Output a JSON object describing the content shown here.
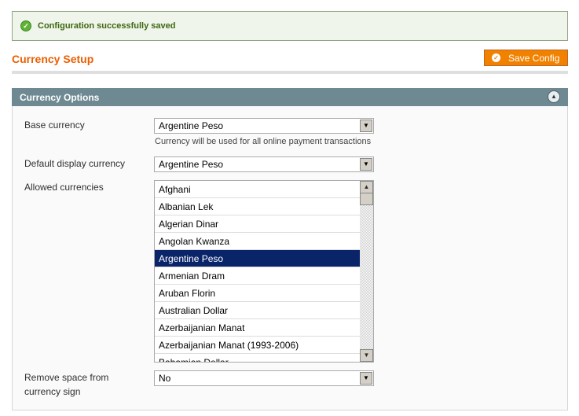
{
  "message": {
    "text": "Configuration successfully saved",
    "icon": "check-circle-icon"
  },
  "page": {
    "title": "Currency Setup",
    "save_label": "Save Config"
  },
  "section": {
    "title": "Currency Options"
  },
  "fields": {
    "base": {
      "label": "Base currency",
      "value": "Argentine Peso",
      "note": "Currency will be used for all online payment transactions"
    },
    "display": {
      "label": "Default display currency",
      "value": "Argentine Peso"
    },
    "allowed": {
      "label": "Allowed currencies",
      "options": [
        "Afghani",
        "Albanian Lek",
        "Algerian Dinar",
        "Angolan Kwanza",
        "Argentine Peso",
        "Armenian Dram",
        "Aruban Florin",
        "Australian Dollar",
        "Azerbaijanian Manat",
        "Azerbaijanian Manat (1993-2006)",
        "Bahamian Dollar"
      ],
      "selected": "Argentine Peso"
    },
    "space": {
      "label_1": "Remove space from",
      "label_2": "currency sign",
      "value": "No"
    }
  },
  "colors": {
    "accent": "#eb5e00",
    "header": "#6f8992",
    "selected": "#0a246a"
  }
}
